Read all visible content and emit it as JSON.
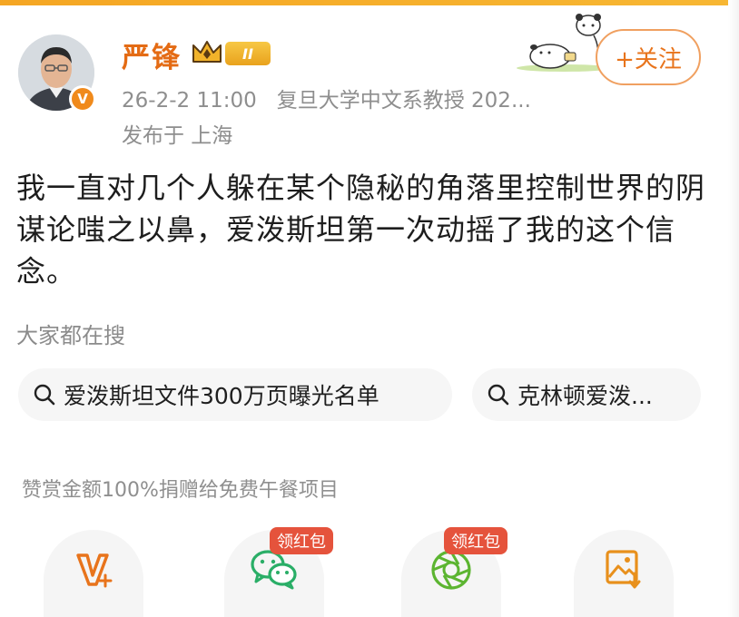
{
  "author": {
    "name": "严锋",
    "level_badge": "II",
    "verified_mark": "V"
  },
  "post_meta": {
    "time": "26-2-2 11:00",
    "bio": "复旦大学中文系教授 202...",
    "location": "发布于 上海"
  },
  "follow_button": {
    "label": "+关注"
  },
  "content": "我一直对几个人躲在某个隐秘的角落里控制世界的阴谋论嗤之以鼻，爱泼斯坦第一次动摇了我的这个信念。",
  "search": {
    "heading": "大家都在搜",
    "chips": [
      "爱泼斯坦文件300万页曝光名单",
      "克林顿爱泼..."
    ]
  },
  "reward_note": "赞赏金额100%捐赠给免费午餐项目",
  "actions": {
    "red_packet_1": "领红包",
    "red_packet_2": "领红包",
    "icons": [
      "reward-v-icon",
      "wechat-icon",
      "moments-icon",
      "save-image-icon"
    ]
  },
  "colors": {
    "accent": "#e8741c",
    "name": "#e46b14",
    "red_packet": "#e5533c",
    "meta_text": "#8e8e8e"
  }
}
